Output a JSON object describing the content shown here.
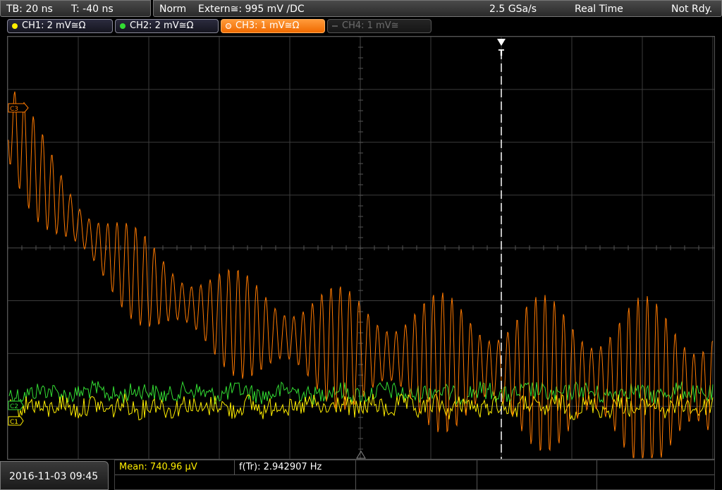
{
  "status_bar": {
    "timebase": "TB: 20 ns",
    "trigger_time": "T: -40 ns",
    "trigger_mode": "Norm",
    "trigger_source": "Extern≅: 995 mV ∕DC",
    "sample_rate": "2.5 GSa/s",
    "acquisition_mode": "Real Time",
    "status": "Not Rdy."
  },
  "channels": [
    {
      "label": "CH1: 2 mV≅Ω",
      "color": "#ffee00",
      "state": "on"
    },
    {
      "label": "CH2: 2 mV≅Ω",
      "color": "#33dd33",
      "state": "on"
    },
    {
      "label": "CH3: 1 mV≅Ω",
      "color": "#ff7a00",
      "state": "active"
    },
    {
      "label": "CH4: 1 mV≅",
      "color": "#555555",
      "state": "off"
    }
  ],
  "markers": {
    "ch3_offset": "C3",
    "ch2_offset": "C2",
    "ch1_offset": "C1",
    "trigger": "T"
  },
  "measurements": {
    "mean": "Mean: 740.96 µV",
    "freq": "f(Tr): 2.942907 Hz"
  },
  "datetime": "2016-11-03 09:45",
  "colors": {
    "ch1": "#ffee00",
    "ch2": "#33dd33",
    "ch3": "#ff7a00",
    "grid": "#3c3c3c",
    "measurement_mean": "#ffee00"
  }
}
